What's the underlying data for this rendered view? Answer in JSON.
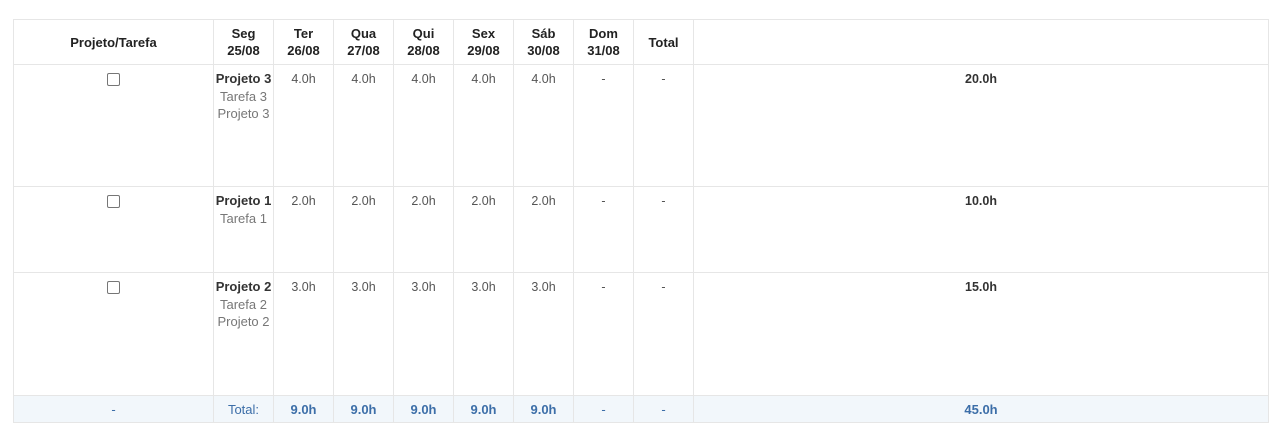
{
  "header": {
    "project_task": "Projeto/Tarefa",
    "days": [
      {
        "day": "Seg",
        "date": "25/08"
      },
      {
        "day": "Ter",
        "date": "26/08"
      },
      {
        "day": "Qua",
        "date": "27/08"
      },
      {
        "day": "Qui",
        "date": "28/08"
      },
      {
        "day": "Sex",
        "date": "29/08"
      },
      {
        "day": "Sáb",
        "date": "30/08"
      },
      {
        "day": "Dom",
        "date": "31/08"
      }
    ],
    "total": "Total"
  },
  "rows": [
    {
      "project": "Projeto 3",
      "task": "Tarefa 3",
      "project_sub": "Projeto 3",
      "hours": [
        "4.0h",
        "4.0h",
        "4.0h",
        "4.0h",
        "4.0h",
        "-",
        "-"
      ],
      "total": "20.0h"
    },
    {
      "project": "Projeto 1",
      "task": "Tarefa 1",
      "project_sub": "",
      "hours": [
        "2.0h",
        "2.0h",
        "2.0h",
        "2.0h",
        "2.0h",
        "-",
        "-"
      ],
      "total": "10.0h"
    },
    {
      "project": "Projeto 2",
      "task": "Tarefa 2",
      "project_sub": "Projeto 2",
      "hours": [
        "3.0h",
        "3.0h",
        "3.0h",
        "3.0h",
        "3.0h",
        "-",
        "-"
      ],
      "total": "15.0h"
    }
  ],
  "footer": {
    "first": "-",
    "label": "Total:",
    "hours": [
      "9.0h",
      "9.0h",
      "9.0h",
      "9.0h",
      "9.0h",
      "-",
      "-"
    ],
    "total": "45.0h"
  }
}
